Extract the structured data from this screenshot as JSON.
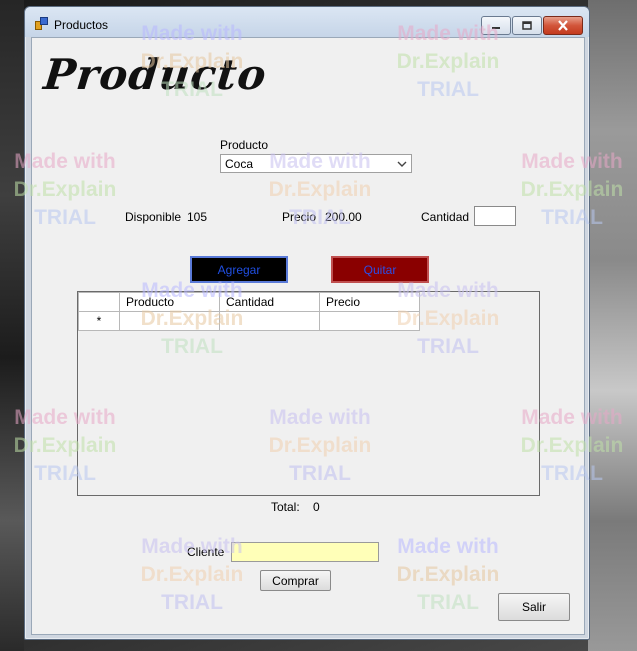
{
  "window": {
    "title": "Productos",
    "logo_text": "Producto"
  },
  "form": {
    "producto_label": "Producto",
    "producto_value": "Coca",
    "disponible_label": "Disponible",
    "disponible_value": "105",
    "precio_label": "Precio",
    "precio_value": "200.00",
    "cantidad_label": "Cantidad",
    "cantidad_value": ""
  },
  "buttons": {
    "agregar": "Agregar",
    "quitar": "Quitar",
    "comprar": "Comprar",
    "salir": "Salir"
  },
  "grid": {
    "columns": [
      "Producto",
      "Cantidad",
      "Precio"
    ],
    "new_row_marker": "*",
    "rows": []
  },
  "total": {
    "label": "Total:",
    "value": "0"
  },
  "cliente": {
    "label": "Cliente",
    "value": ""
  },
  "watermark": {
    "line1": "Made with",
    "line2": "Dr.Explain",
    "line3": "TRIAL"
  },
  "colors": {
    "agregar_bg": "#000000",
    "quitar_bg": "#8a0000",
    "button_text": "#1f4ee0",
    "cliente_bg": "#ffffb8"
  }
}
